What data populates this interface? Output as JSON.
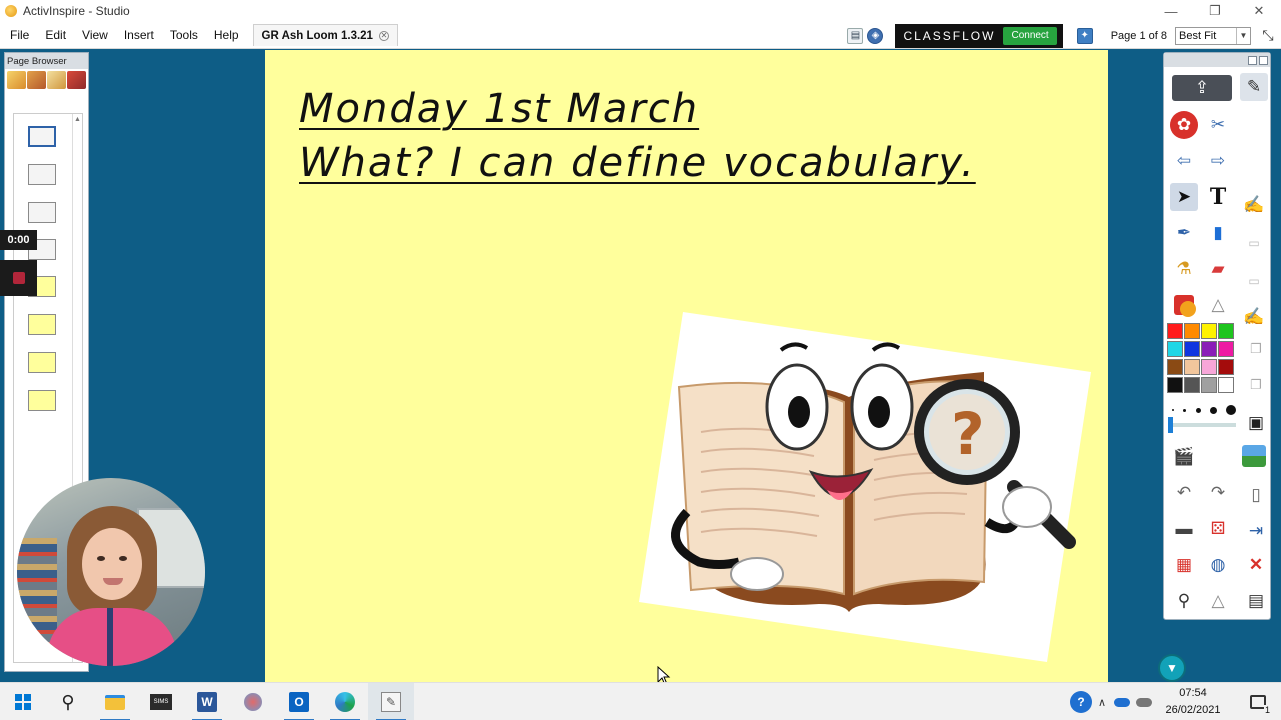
{
  "window": {
    "title": "ActivInspire - Studio",
    "controls": {
      "minimize": "—",
      "restore": "❐",
      "close": "✕"
    }
  },
  "menu": {
    "items": [
      "File",
      "Edit",
      "View",
      "Insert",
      "Tools",
      "Help"
    ],
    "flipchart_tab": "GR Ash Loom 1.3.21"
  },
  "toolbar_right": {
    "classflow_label": "CLASSFLOW",
    "connect_label": "Connect",
    "page_info": "Page 1 of 8",
    "zoom_value": "Best Fit"
  },
  "page_browser": {
    "title": "Page Browser",
    "page_count": 8,
    "active_page": 1
  },
  "recording": {
    "timer": "0:00"
  },
  "flipchart": {
    "line1": "Monday 1st March",
    "line2": "What? I can define vocabulary."
  },
  "taskbar": {
    "apps": [
      "start",
      "search",
      "file-explorer",
      "sims",
      "word",
      "snipping",
      "outlook",
      "edge",
      "activinspire"
    ],
    "time": "07:54",
    "date": "26/02/2021",
    "notification_count": "1"
  },
  "colors": {
    "desktop_bg": "#0e5d86",
    "page_bg": "#ffff9c",
    "classflow_green": "#27a33f"
  }
}
